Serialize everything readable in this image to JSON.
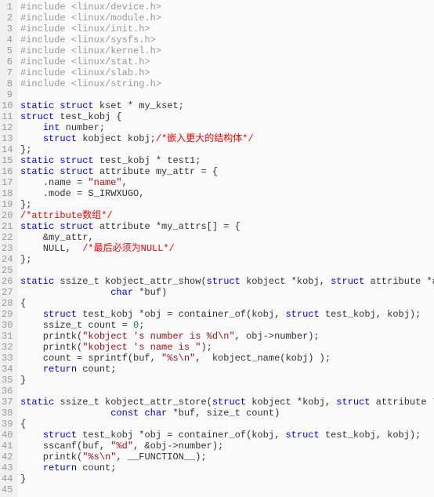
{
  "editor": {
    "lines": [
      {
        "n": 1,
        "tokens": [
          {
            "t": "#include ",
            "c": "pp"
          },
          {
            "t": "<linux/device.h>",
            "c": "pp"
          }
        ]
      },
      {
        "n": 2,
        "tokens": [
          {
            "t": "#include ",
            "c": "pp"
          },
          {
            "t": "<linux/module.h>",
            "c": "pp"
          }
        ]
      },
      {
        "n": 3,
        "tokens": [
          {
            "t": "#include ",
            "c": "pp"
          },
          {
            "t": "<linux/init.h>",
            "c": "pp"
          }
        ]
      },
      {
        "n": 4,
        "tokens": [
          {
            "t": "#include ",
            "c": "pp"
          },
          {
            "t": "<linux/sysfs.h>",
            "c": "pp"
          }
        ]
      },
      {
        "n": 5,
        "tokens": [
          {
            "t": "#include ",
            "c": "pp"
          },
          {
            "t": "<linux/kernel.h>",
            "c": "pp"
          }
        ]
      },
      {
        "n": 6,
        "tokens": [
          {
            "t": "#include ",
            "c": "pp"
          },
          {
            "t": "<linux/stat.h>",
            "c": "pp"
          }
        ]
      },
      {
        "n": 7,
        "tokens": [
          {
            "t": "#include ",
            "c": "pp"
          },
          {
            "t": "<linux/slab.h>",
            "c": "pp"
          }
        ]
      },
      {
        "n": 8,
        "tokens": [
          {
            "t": "#include ",
            "c": "pp"
          },
          {
            "t": "<linux/string.h>",
            "c": "pp"
          }
        ]
      },
      {
        "n": 9,
        "tokens": []
      },
      {
        "n": 10,
        "tokens": [
          {
            "t": "static",
            "c": "kw"
          },
          {
            "t": " ",
            "c": ""
          },
          {
            "t": "struct",
            "c": "kw"
          },
          {
            "t": " kset * my_kset;",
            "c": ""
          }
        ]
      },
      {
        "n": 11,
        "tokens": [
          {
            "t": "struct",
            "c": "kw"
          },
          {
            "t": " test_kobj {",
            "c": ""
          }
        ]
      },
      {
        "n": 12,
        "tokens": [
          {
            "t": "    ",
            "c": ""
          },
          {
            "t": "int",
            "c": "kw"
          },
          {
            "t": " number;",
            "c": ""
          }
        ]
      },
      {
        "n": 13,
        "tokens": [
          {
            "t": "    ",
            "c": ""
          },
          {
            "t": "struct",
            "c": "kw"
          },
          {
            "t": " kobject kobj;",
            "c": ""
          },
          {
            "t": "/*嵌入更大的结构体*/",
            "c": "cmt"
          }
        ]
      },
      {
        "n": 14,
        "tokens": [
          {
            "t": "};",
            "c": ""
          }
        ]
      },
      {
        "n": 15,
        "tokens": [
          {
            "t": "static",
            "c": "kw"
          },
          {
            "t": " ",
            "c": ""
          },
          {
            "t": "struct",
            "c": "kw"
          },
          {
            "t": " test_kobj * test1;",
            "c": ""
          }
        ]
      },
      {
        "n": 16,
        "tokens": [
          {
            "t": "static",
            "c": "kw"
          },
          {
            "t": " ",
            "c": ""
          },
          {
            "t": "struct",
            "c": "kw"
          },
          {
            "t": " attribute my_attr = {",
            "c": ""
          }
        ]
      },
      {
        "n": 17,
        "tokens": [
          {
            "t": "    .name = ",
            "c": ""
          },
          {
            "t": "\"name\"",
            "c": "str"
          },
          {
            "t": ",",
            "c": ""
          }
        ]
      },
      {
        "n": 18,
        "tokens": [
          {
            "t": "    .mode = S_IRWXUGO,",
            "c": ""
          }
        ]
      },
      {
        "n": 19,
        "tokens": [
          {
            "t": "};",
            "c": ""
          }
        ]
      },
      {
        "n": 20,
        "tokens": [
          {
            "t": "/*attribute数组*/",
            "c": "cmt"
          }
        ]
      },
      {
        "n": 21,
        "tokens": [
          {
            "t": "static",
            "c": "kw"
          },
          {
            "t": " ",
            "c": ""
          },
          {
            "t": "struct",
            "c": "kw"
          },
          {
            "t": " attribute *my_attrs[] = {",
            "c": ""
          }
        ]
      },
      {
        "n": 22,
        "tokens": [
          {
            "t": "    &my_attr,",
            "c": ""
          }
        ]
      },
      {
        "n": 23,
        "tokens": [
          {
            "t": "    NULL,  ",
            "c": ""
          },
          {
            "t": "/*最后必须为NULL*/",
            "c": "cmt"
          }
        ]
      },
      {
        "n": 24,
        "tokens": [
          {
            "t": "};",
            "c": ""
          }
        ]
      },
      {
        "n": 25,
        "tokens": []
      },
      {
        "n": 26,
        "tokens": [
          {
            "t": "static",
            "c": "kw"
          },
          {
            "t": " ssize_t kobject_attr_show(",
            "c": ""
          },
          {
            "t": "struct",
            "c": "kw"
          },
          {
            "t": " kobject *kobj, ",
            "c": ""
          },
          {
            "t": "struct",
            "c": "kw"
          },
          {
            "t": " attribute *attr,",
            "c": ""
          }
        ]
      },
      {
        "n": 27,
        "tokens": [
          {
            "t": "                ",
            "c": ""
          },
          {
            "t": "char",
            "c": "kw"
          },
          {
            "t": " *buf)",
            "c": ""
          }
        ]
      },
      {
        "n": 28,
        "tokens": [
          {
            "t": "{",
            "c": ""
          }
        ]
      },
      {
        "n": 29,
        "tokens": [
          {
            "t": "    ",
            "c": ""
          },
          {
            "t": "struct",
            "c": "kw"
          },
          {
            "t": " test_kobj *obj = container_of(kobj, ",
            "c": ""
          },
          {
            "t": "struct",
            "c": "kw"
          },
          {
            "t": " test_kobj, kobj);",
            "c": ""
          }
        ]
      },
      {
        "n": 30,
        "tokens": [
          {
            "t": "    ssize_t count = ",
            "c": ""
          },
          {
            "t": "0",
            "c": "num"
          },
          {
            "t": ";",
            "c": ""
          }
        ]
      },
      {
        "n": 31,
        "tokens": [
          {
            "t": "    printk(",
            "c": ""
          },
          {
            "t": "\"kobject 's number is %d\\n\"",
            "c": "str"
          },
          {
            "t": ", obj->number);",
            "c": ""
          }
        ]
      },
      {
        "n": 32,
        "tokens": [
          {
            "t": "    printk(",
            "c": ""
          },
          {
            "t": "\"kobject 's name is \"",
            "c": "str"
          },
          {
            "t": ");",
            "c": ""
          }
        ]
      },
      {
        "n": 33,
        "tokens": [
          {
            "t": "    count = sprintf(buf, ",
            "c": ""
          },
          {
            "t": "\"%s\\n\"",
            "c": "str"
          },
          {
            "t": ",  kobject_name(kobj) );",
            "c": ""
          }
        ]
      },
      {
        "n": 34,
        "tokens": [
          {
            "t": "    ",
            "c": ""
          },
          {
            "t": "return",
            "c": "kw"
          },
          {
            "t": " count;",
            "c": ""
          }
        ]
      },
      {
        "n": 35,
        "tokens": [
          {
            "t": "}",
            "c": ""
          }
        ]
      },
      {
        "n": 36,
        "tokens": []
      },
      {
        "n": 37,
        "tokens": [
          {
            "t": "static",
            "c": "kw"
          },
          {
            "t": " ssize_t kobject_attr_store(",
            "c": ""
          },
          {
            "t": "struct",
            "c": "kw"
          },
          {
            "t": " kobject *kobj, ",
            "c": ""
          },
          {
            "t": "struct",
            "c": "kw"
          },
          {
            "t": " attribute *attr,",
            "c": ""
          }
        ]
      },
      {
        "n": 38,
        "tokens": [
          {
            "t": "                ",
            "c": ""
          },
          {
            "t": "const",
            "c": "kw"
          },
          {
            "t": " ",
            "c": ""
          },
          {
            "t": "char",
            "c": "kw"
          },
          {
            "t": " *buf, size_t count)",
            "c": ""
          }
        ]
      },
      {
        "n": 39,
        "tokens": [
          {
            "t": "{",
            "c": ""
          }
        ]
      },
      {
        "n": 40,
        "tokens": [
          {
            "t": "    ",
            "c": ""
          },
          {
            "t": "struct",
            "c": "kw"
          },
          {
            "t": " test_kobj *obj = container_of(kobj, ",
            "c": ""
          },
          {
            "t": "struct",
            "c": "kw"
          },
          {
            "t": " test_kobj, kobj);",
            "c": ""
          }
        ]
      },
      {
        "n": 41,
        "tokens": [
          {
            "t": "    sscanf(buf, ",
            "c": ""
          },
          {
            "t": "\"%d\"",
            "c": "str"
          },
          {
            "t": ", &obj->number);",
            "c": ""
          }
        ]
      },
      {
        "n": 42,
        "tokens": [
          {
            "t": "    printk(",
            "c": ""
          },
          {
            "t": "\"%s\\n\"",
            "c": "str"
          },
          {
            "t": ", __FUNCTION__);",
            "c": ""
          }
        ]
      },
      {
        "n": 43,
        "tokens": [
          {
            "t": "    ",
            "c": ""
          },
          {
            "t": "return",
            "c": "kw"
          },
          {
            "t": " count;",
            "c": ""
          }
        ]
      },
      {
        "n": 44,
        "tokens": [
          {
            "t": "}",
            "c": ""
          }
        ]
      },
      {
        "n": 45,
        "tokens": []
      }
    ]
  }
}
